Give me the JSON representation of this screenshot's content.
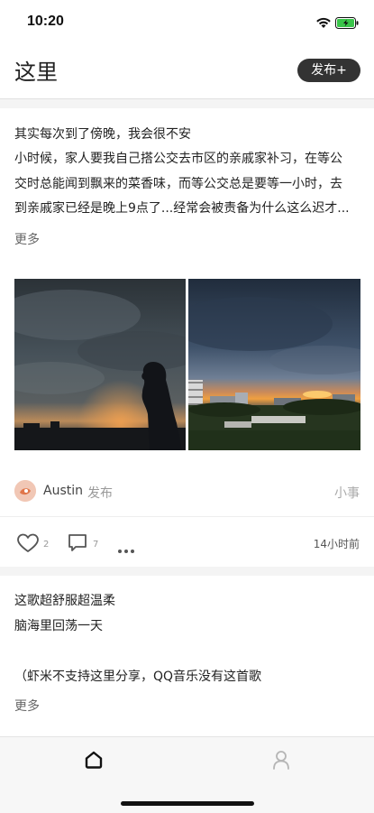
{
  "status": {
    "time": "10:20"
  },
  "header": {
    "title": "这里",
    "publish_label": "发布+"
  },
  "post1": {
    "lines": [
      "其实每次到了傍晚，我会很不安",
      "小时候，家人要我自己搭公交去市区的亲戚家补习，在等公",
      "交时总能闻到飘来的菜香味，而等公交总是要等一小时，去",
      "到亲戚家已经是晚上9点了...经常会被责备为什么这么迟才..."
    ],
    "more": "更多",
    "author": "Austin",
    "author_action": "发布",
    "category": "小事",
    "likes": "2",
    "comments": "7",
    "time": "14小时前"
  },
  "post2": {
    "lines": [
      "这歌超舒服超温柔",
      "脑海里回荡一天",
      "",
      "（虾米不支持这里分享，QQ音乐没有这首歌"
    ],
    "more": "更多"
  },
  "colors": {
    "publish_bg": "#333333",
    "divider": "#f4f4f4",
    "tab_active": "#111111",
    "tab_inactive": "#bbbbbb"
  },
  "icons": {
    "like": "heart-outline",
    "comment": "speech-bubble",
    "more": "ellipsis",
    "home": "house",
    "profile": "person"
  }
}
